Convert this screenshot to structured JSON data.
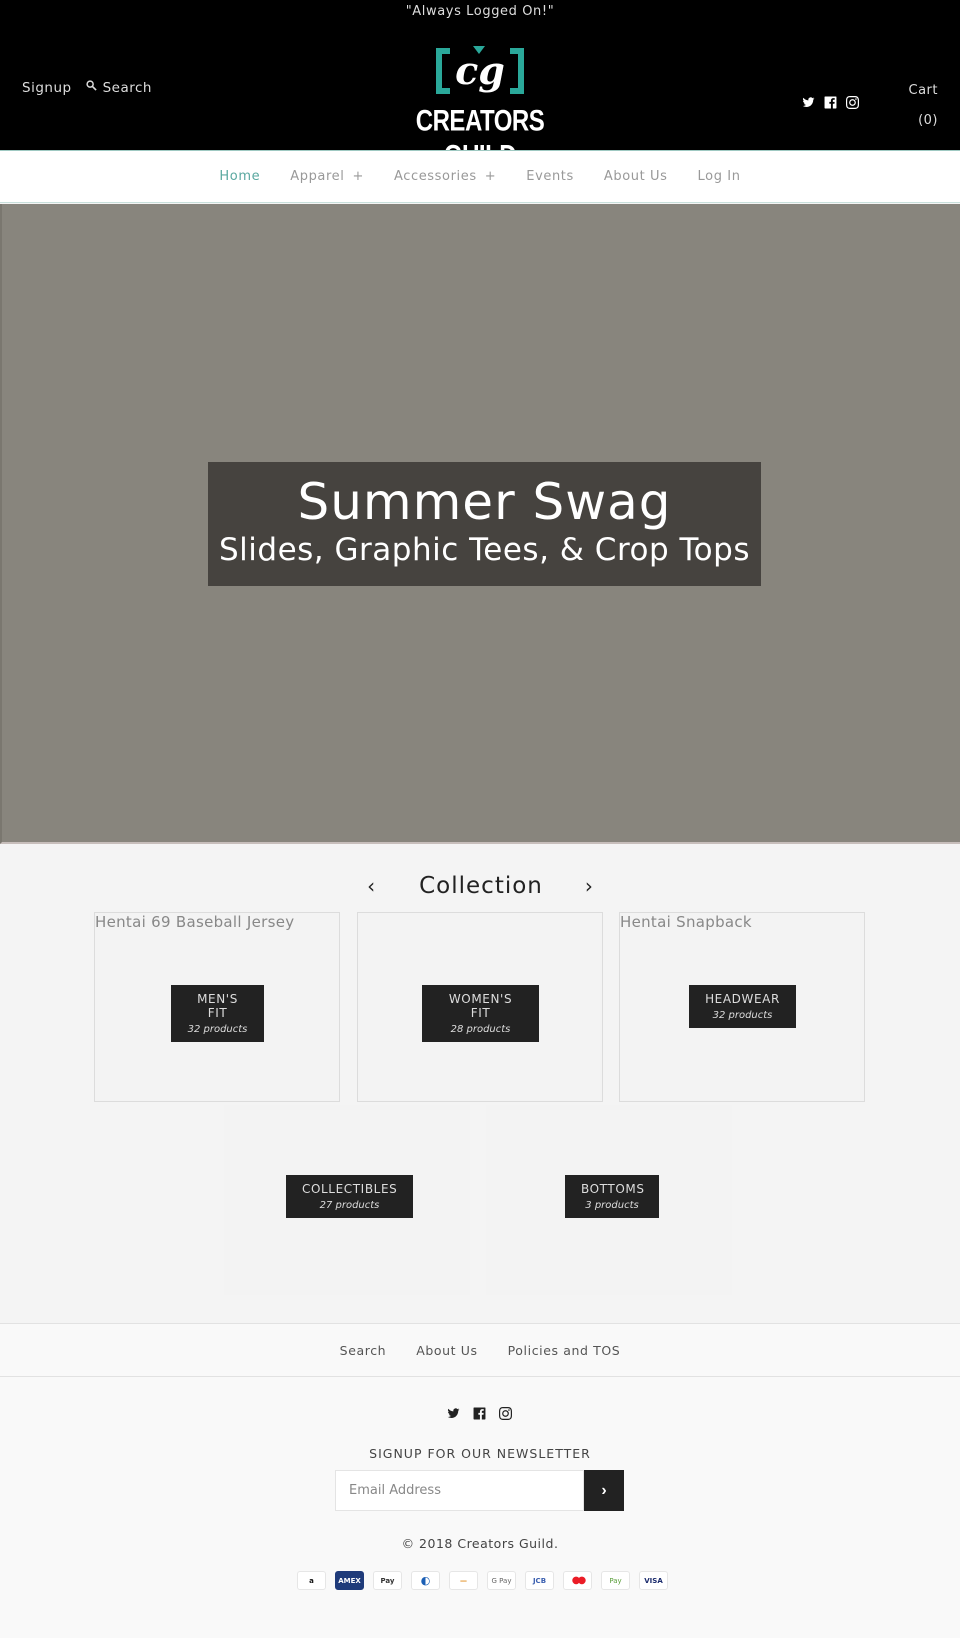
{
  "header": {
    "announcement": "\"Always Logged On!\"",
    "signup_label": "Signup",
    "search_label": "Search",
    "logo_monogram": "cg",
    "logo_wordmark": "CREATORS GUILD",
    "cart_label": "Cart",
    "cart_count": "(0)",
    "social": [
      "twitter-icon",
      "facebook-icon",
      "instagram-icon"
    ],
    "accent_color": "#2aa89a"
  },
  "nav": {
    "items": [
      {
        "label": "Home",
        "active": true,
        "has_submenu": false
      },
      {
        "label": "Apparel",
        "active": false,
        "has_submenu": true
      },
      {
        "label": "Accessories",
        "active": false,
        "has_submenu": true
      },
      {
        "label": "Events",
        "active": false,
        "has_submenu": false
      },
      {
        "label": "About Us",
        "active": false,
        "has_submenu": false
      },
      {
        "label": "Log In",
        "active": false,
        "has_submenu": false
      }
    ],
    "submenu_symbol": "+",
    "active_color": "#5aa8a0"
  },
  "hero": {
    "title": "Summer Swag",
    "subtitle": "Slides, Graphic Tees, & Crop Tops"
  },
  "collection": {
    "title": "Collection",
    "prev_symbol": "‹",
    "next_symbol": "›",
    "tiles": [
      {
        "image_alt": "Hentai 69 Baseball Jersey",
        "name_line1": "MEN'S",
        "name_line2": "FIT",
        "count": "32 products"
      },
      {
        "image_alt": "",
        "name_line1": "WOMEN'S",
        "name_line2": "FIT",
        "count": "28 products"
      },
      {
        "image_alt": "Hentai Snapback",
        "name_line1": "HEADWEAR",
        "name_line2": "",
        "count": "32 products"
      },
      {
        "image_alt": "",
        "name_line1": "COLLECTIBLES",
        "name_line2": "",
        "count": "27 products"
      },
      {
        "image_alt": "",
        "name_line1": "BOTTOMS",
        "name_line2": "",
        "count": "3 products"
      }
    ]
  },
  "footer": {
    "links": [
      "Search",
      "About Us",
      "Policies and TOS"
    ],
    "social": [
      "twitter-icon",
      "facebook-icon",
      "instagram-icon"
    ],
    "newsletter_title": "SIGNUP FOR OUR NEWSLETTER",
    "email_placeholder": "Email Address",
    "email_value": "",
    "submit_symbol": "›",
    "copyright": "© 2018 Creators Guild.",
    "payments": [
      {
        "name": "amazon",
        "label": "a"
      },
      {
        "name": "amex",
        "label": "AMEX"
      },
      {
        "name": "apple-pay",
        "label": "Pay"
      },
      {
        "name": "diners-club",
        "label": "◐"
      },
      {
        "name": "discover",
        "label": "—"
      },
      {
        "name": "google-pay",
        "label": "G Pay"
      },
      {
        "name": "jcb",
        "label": "JCB"
      },
      {
        "name": "mastercard",
        "label": "●●"
      },
      {
        "name": "shopify-pay",
        "label": "Pay"
      },
      {
        "name": "visa",
        "label": "VISA"
      }
    ]
  }
}
